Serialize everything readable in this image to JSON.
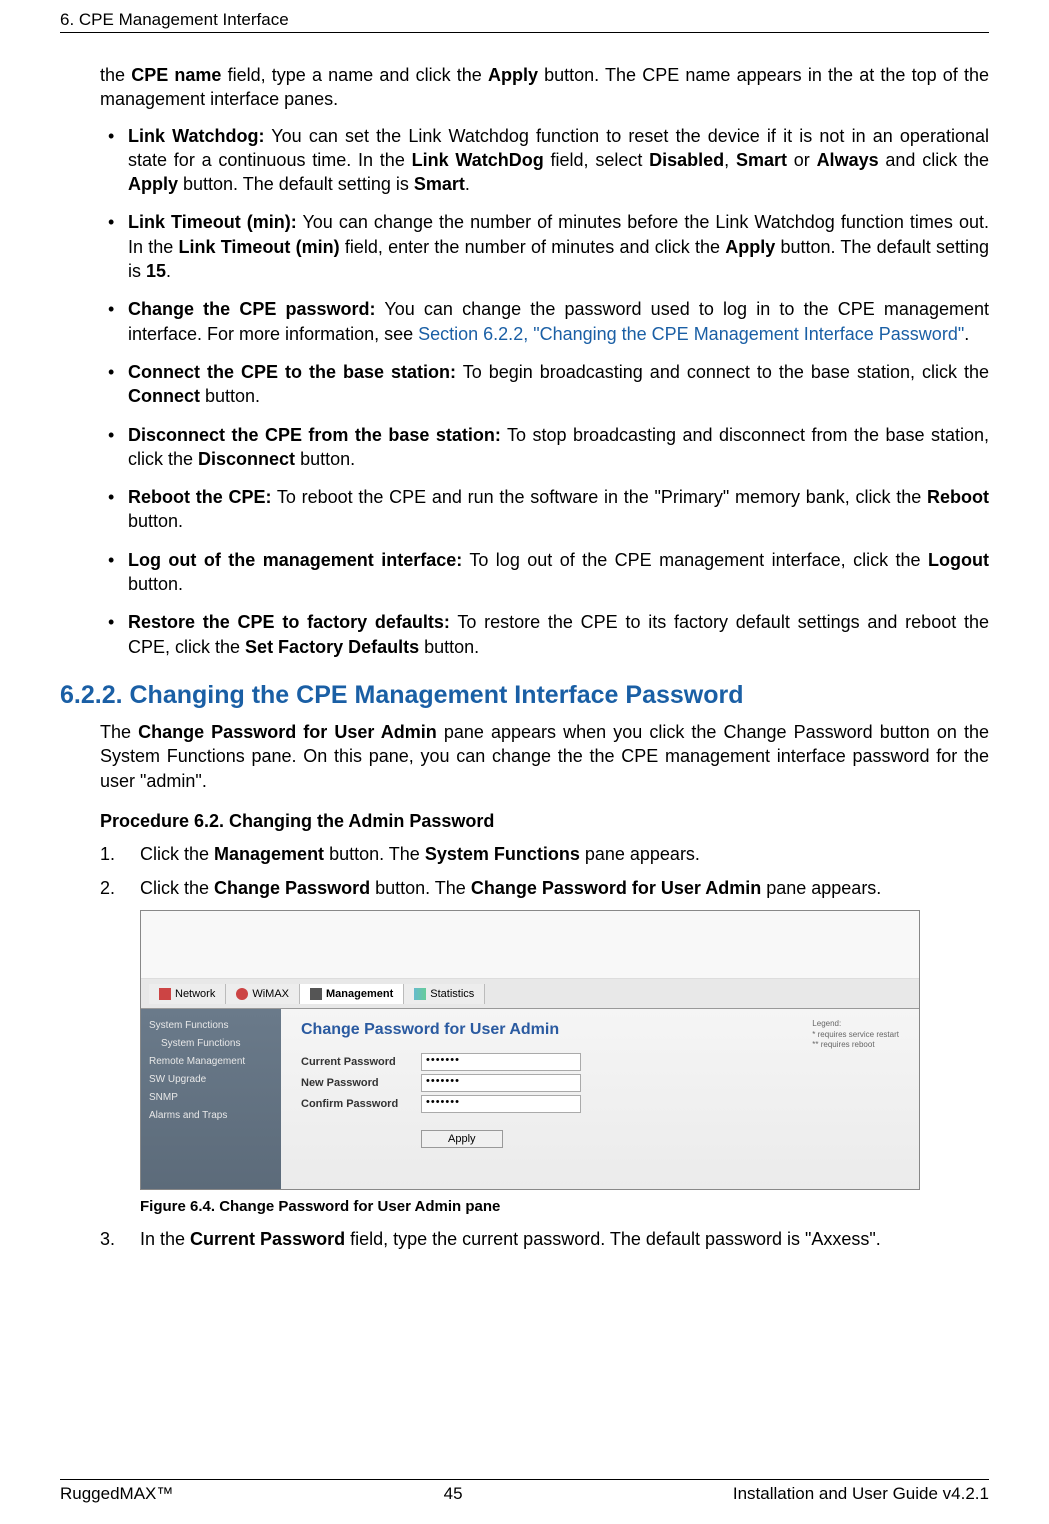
{
  "header": "6. CPE Management Interface",
  "intro_text": {
    "part1": "the ",
    "cpe_name": "CPE name",
    "part2": " field, type a name and click the ",
    "apply": "Apply",
    "part3": " button. The CPE name appears in the at the top of the management interface panes."
  },
  "bullets": {
    "b1": {
      "title": "Link Watchdog:",
      "p1": " You can set the Link Watchdog function to reset the device if it is not in an operational state for a continuous time. In the ",
      "f1": "Link WatchDog",
      "p2": " field, select ",
      "o1": "Disabled",
      "p3": ", ",
      "o2": "Smart",
      "p4": " or ",
      "o3": "Always",
      "p5": " and click the ",
      "btn": "Apply",
      "p6": " button. The default setting is ",
      "def": "Smart",
      "p7": "."
    },
    "b2": {
      "title": "Link Timeout (min):",
      "p1": " You can change the number of minutes before the Link Watchdog function times out. In the ",
      "f1": "Link Timeout (min)",
      "p2": " field, enter the number of minutes and click the ",
      "btn": "Apply",
      "p3": " button. The default setting is ",
      "def": "15",
      "p4": "."
    },
    "b3": {
      "title": "Change the CPE password:",
      "p1": " You can change the password used to log in to the CPE management interface. For more information, see ",
      "link": "Section 6.2.2, \"Changing the CPE Management Interface Password\"",
      "p2": "."
    },
    "b4": {
      "title": "Connect the CPE to the base station:",
      "p1": " To begin broadcasting and connect to the base station, click the ",
      "btn": "Connect",
      "p2": " button."
    },
    "b5": {
      "title": "Disconnect the CPE from the base station:",
      "p1": " To stop broadcasting and disconnect from the base station, click the ",
      "btn": "Disconnect",
      "p2": " button."
    },
    "b6": {
      "title": "Reboot the CPE:",
      "p1": " To reboot the CPE and run the software in the \"Primary\" memory bank, click the ",
      "btn": "Reboot",
      "p2": " button."
    },
    "b7": {
      "title": "Log out of the management interface:",
      "p1": " To log out of the CPE management interface, click the ",
      "btn": "Logout",
      "p2": " button."
    },
    "b8": {
      "title": "Restore the CPE to factory defaults:",
      "p1": " To restore the CPE to its factory default settings and reboot the CPE, click the ",
      "btn": "Set Factory Defaults",
      "p2": " button."
    }
  },
  "section_heading": "6.2.2. Changing the CPE Management Interface Password",
  "section_intro": {
    "p1": "The ",
    "b1": "Change Password for User Admin",
    "p2": " pane appears when you click the Change Password button on the System Functions pane. On this pane, you can change the the CPE management interface password for the user \"admin\"."
  },
  "procedure_title": "Procedure 6.2. Changing the Admin Password",
  "steps": {
    "s1": {
      "p1": "Click the ",
      "b1": "Management",
      "p2": " button. The ",
      "b2": "System Functions",
      "p3": " pane appears."
    },
    "s2": {
      "p1": "Click the ",
      "b1": "Change Password",
      "p2": " button. The ",
      "b2": "Change Password for User Admin",
      "p3": " pane appears."
    },
    "s3": {
      "p1": "In the ",
      "b1": "Current Password",
      "p2": " field, type the current password. The default password is \"Axxess\"."
    }
  },
  "ui": {
    "tabs": {
      "network": "Network",
      "wimax": "WiMAX",
      "management": "Management",
      "statistics": "Statistics"
    },
    "sidebar": {
      "i1": "System Functions",
      "i2": "System Functions",
      "i3": "Remote Management",
      "i4": "SW Upgrade",
      "i5": "SNMP",
      "i6": "Alarms and Traps"
    },
    "pane_title": "Change Password for User Admin",
    "legend": {
      "title": "Legend:",
      "l1": "* requires service restart",
      "l2": "** requires reboot"
    },
    "form": {
      "current": "Current Password",
      "new": "New Password",
      "confirm": "Confirm Password",
      "dots": "•••••••"
    },
    "apply": "Apply"
  },
  "figure_caption": "Figure 6.4. Change Password for User Admin pane",
  "footer": {
    "left": "RuggedMAX™",
    "center": "45",
    "right": "Installation and User Guide v4.2.1"
  }
}
